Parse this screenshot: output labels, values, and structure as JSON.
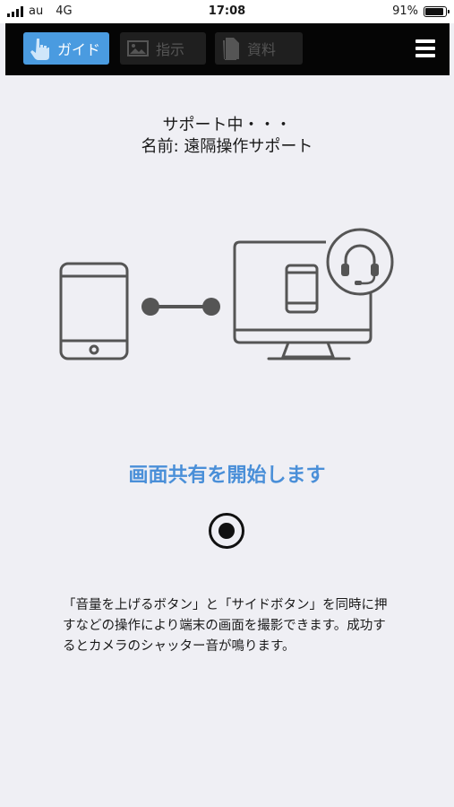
{
  "status_bar": {
    "carrier": "au",
    "network": "4G",
    "time": "17:08",
    "battery_percent": "91%",
    "battery_level": 0.91
  },
  "toolbar": {
    "tabs": [
      {
        "label": "ガイド",
        "icon": "hand-pointer-icon",
        "active": true
      },
      {
        "label": "指示",
        "icon": "image-icon",
        "active": false
      },
      {
        "label": "資料",
        "icon": "document-icon",
        "active": false
      }
    ],
    "menu_icon": "hamburger-menu-icon"
  },
  "status": {
    "line1": "サポート中・・・",
    "line2": "名前: 遠隔操作サポート"
  },
  "share": {
    "title": "画面共有を開始します",
    "title_color": "#4a8fd8"
  },
  "description": "「音量を上げるボタン」と「サイドボタン」を同時に押すなどの操作により端末の画面を撮影できます。成功するとカメラのシャッター音が鳴ります。",
  "colors": {
    "accent": "#4a9be0",
    "background": "#efeff4",
    "toolbar": "#050505"
  }
}
